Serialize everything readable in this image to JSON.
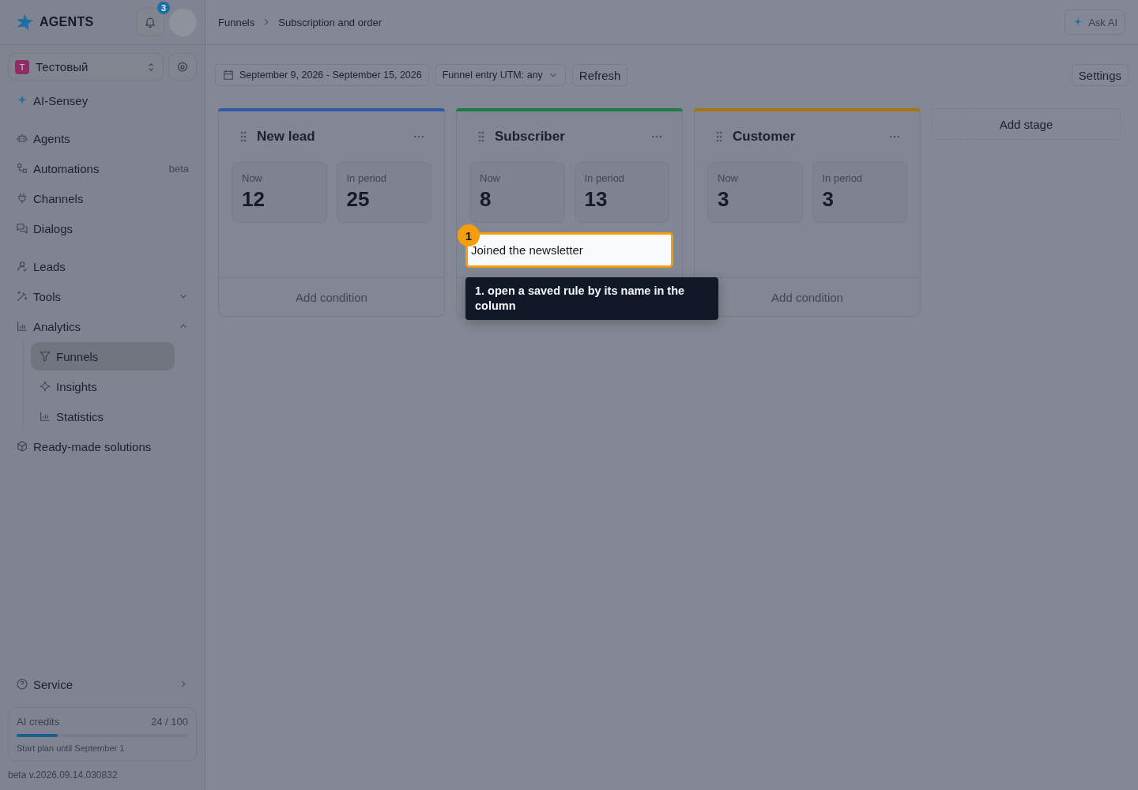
{
  "brand": {
    "name": "AGENTS"
  },
  "notifications": {
    "count": "3"
  },
  "workspace": {
    "initial": "T",
    "name": "Тестовый"
  },
  "sidebar": {
    "sections": [
      [
        {
          "label": "AI-Sensey",
          "selected": false
        }
      ],
      [
        {
          "label": "Agents",
          "selected": false
        },
        {
          "label": "Automations",
          "badge": "beta",
          "selected": false
        },
        {
          "label": "Channels",
          "selected": false
        },
        {
          "label": "Dialogs",
          "selected": false
        }
      ],
      [
        {
          "label": "Leads",
          "selected": false
        },
        {
          "label": "Tools",
          "expanded": false,
          "selected": false
        },
        {
          "label": "Analytics",
          "expanded": true,
          "selected": false,
          "children": [
            {
              "label": "Funnels",
              "selected": true
            },
            {
              "label": "Insights",
              "selected": false
            },
            {
              "label": "Statistics",
              "selected": false
            }
          ]
        },
        {
          "label": "Ready-made solutions",
          "selected": false
        }
      ]
    ],
    "service": {
      "label": "Service"
    },
    "credits": {
      "label": "AI credits",
      "reading": "24 / 100",
      "level": 0.24,
      "note": "Start plan until September 1"
    },
    "version": "beta v.2026.09.14.030832"
  },
  "header": {
    "breadcrumbs": [
      "Funnels",
      "Subscription and order"
    ],
    "ask_ai": "Ask AI"
  },
  "toolbar": {
    "date_range": "September 9, 2026 - September 15, 2026",
    "utm_filter": "Funnel entry UTM: any",
    "refresh": "Refresh",
    "settings": "Settings"
  },
  "stages": [
    {
      "name": "New lead",
      "color": "#2f5aa8",
      "now_label": "Now",
      "now": "12",
      "period_label": "In period",
      "period": "25",
      "add_condition": "Add condition"
    },
    {
      "name": "Subscriber",
      "color": "#1f7a44",
      "now_label": "Now",
      "now": "8",
      "period_label": "In period",
      "period": "13",
      "rules": [
        {
          "name": "Joined the newsletter",
          "highlighted": true
        }
      ]
    },
    {
      "name": "Customer",
      "color": "#a37612",
      "now_label": "Now",
      "now": "3",
      "period_label": "In period",
      "period": "3",
      "add_condition": "Add condition"
    }
  ],
  "add_stage": "Add stage",
  "tour": {
    "step": "1",
    "text": "1. open a saved rule by its name in the column"
  }
}
